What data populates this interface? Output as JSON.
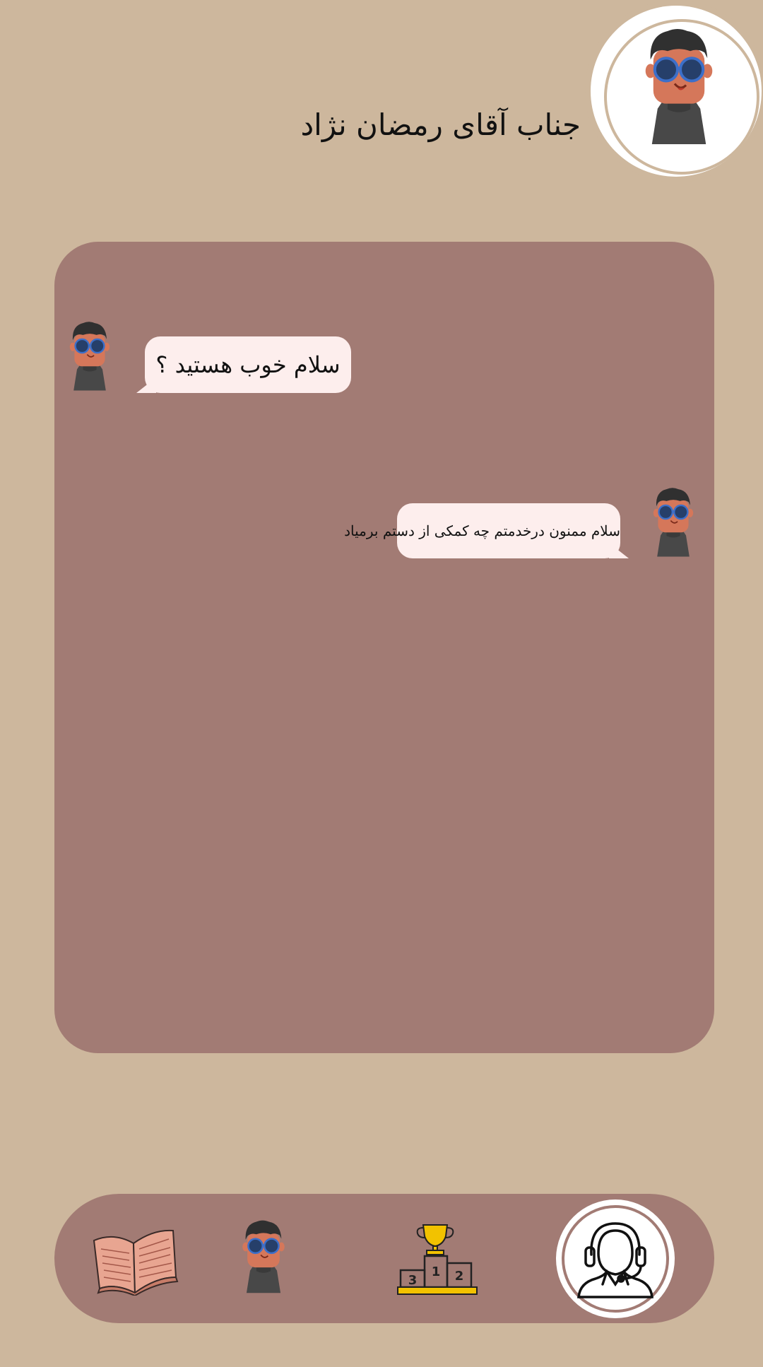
{
  "header": {
    "title": "جناب آقای رمضان نژاد",
    "avatar_icon": "user-avatar-icon"
  },
  "chat": {
    "messages": [
      {
        "text": "سلام خوب هستید ؟",
        "side": "left",
        "avatar_icon": "user-avatar-icon"
      },
      {
        "text": "سلام ممنون درخدمتم چه کمکی از دستم برمیاد",
        "side": "right",
        "avatar_icon": "user-avatar-icon"
      }
    ]
  },
  "nav": {
    "items": [
      {
        "icon": "book-icon"
      },
      {
        "icon": "profile-icon"
      },
      {
        "icon": "leaderboard-icon",
        "podium_labels": [
          "1",
          "2",
          "3"
        ]
      },
      {
        "icon": "support-agent-icon",
        "active": true
      }
    ]
  },
  "colors": {
    "background": "#cdb79d",
    "panel": "#a27b74",
    "bubble": "#fdeeed",
    "trophy": "#f2c200"
  }
}
